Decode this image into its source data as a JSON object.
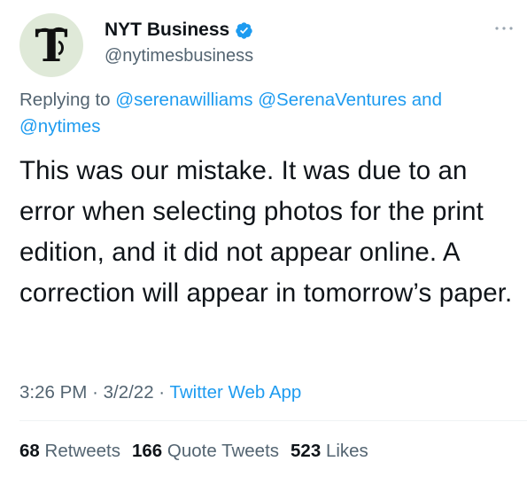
{
  "tweet": {
    "display_name": "NYT Business",
    "handle": "@nytimesbusiness",
    "verified_icon": "verified-badge-icon",
    "more_icon": "more-options-icon",
    "avatar_icon": "nyt-t-logo",
    "replying": {
      "prefix": "Replying to",
      "mention_1": "@serenawilliams",
      "mention_2": "@SerenaVentures",
      "conjunction": "and",
      "mention_3": "@nytimes"
    },
    "body": "This was our mistake. It was due to an error when selecting photos for the print edition, and it did not appear online. A correction will appear in tomorrow’s paper.",
    "time": "3:26 PM",
    "date": "3/2/22",
    "source": "Twitter Web App",
    "separator": "·",
    "stats": {
      "retweets_count": "68",
      "retweets_label": "Retweets",
      "quotes_count": "166",
      "quotes_label": "Quote Tweets",
      "likes_count": "523",
      "likes_label": "Likes"
    }
  },
  "colors": {
    "link": "#1d9bf0",
    "secondary_text": "#536471",
    "primary_text": "#0f1419",
    "avatar_bg": "#dfe9d8"
  }
}
